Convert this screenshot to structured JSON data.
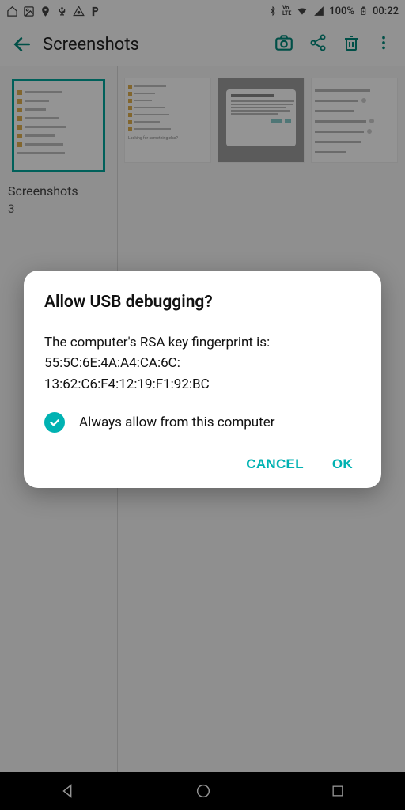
{
  "status": {
    "battery_pct": "100%",
    "time": "00:22",
    "volte": "Vo\nLTE"
  },
  "appbar": {
    "title": "Screenshots"
  },
  "folder": {
    "name": "Screenshots",
    "count": "3"
  },
  "dialog": {
    "title": "Allow USB debugging?",
    "body_intro": "The computer's RSA key fingerprint is:",
    "fingerprint_line1": "55:5C:6E:4A:A4:CA:6C:",
    "fingerprint_line2": "13:62:C6:F4:12:19:F1:92:BC",
    "checkbox_label": "Always allow from this computer",
    "checkbox_checked": true,
    "cancel": "CANCEL",
    "ok": "OK"
  },
  "colors": {
    "accent": "#00b2b2",
    "toolbar_icon": "#00897b"
  }
}
